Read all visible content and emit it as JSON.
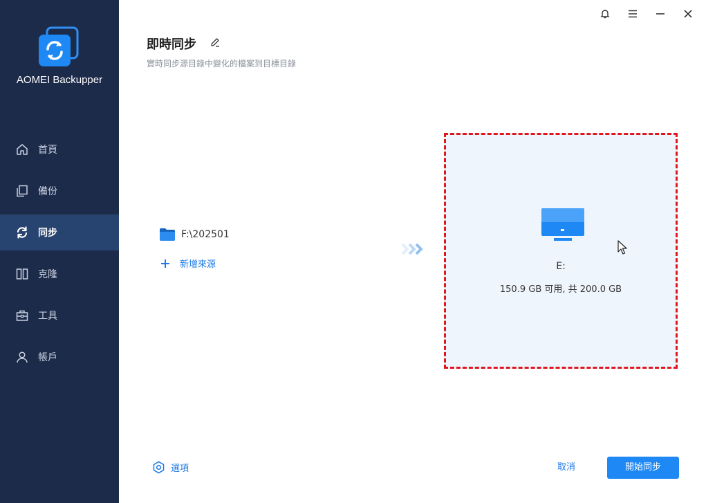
{
  "app": {
    "name": "AOMEI Backupper"
  },
  "nav": [
    {
      "label": "首頁",
      "icon": "home-icon"
    },
    {
      "label": "備份",
      "icon": "backup-icon"
    },
    {
      "label": "同步",
      "icon": "sync-icon",
      "active": true
    },
    {
      "label": "克隆",
      "icon": "clone-icon"
    },
    {
      "label": "工具",
      "icon": "tools-icon"
    },
    {
      "label": "帳戶",
      "icon": "account-icon"
    }
  ],
  "window_controls": [
    "bell-icon",
    "menu-icon",
    "minimize-icon",
    "close-icon"
  ],
  "header": {
    "title": "即時同步",
    "subtitle": "實時同步源目錄中變化的檔案到目標目錄"
  },
  "source": {
    "path": "F:\\202501",
    "add_label": "新增來源"
  },
  "destination": {
    "drive": "E:",
    "space": "150.9 GB 可用, 共 200.0 GB"
  },
  "footer": {
    "options_label": "選項",
    "cancel_label": "取消",
    "start_label": "開始同步"
  },
  "colors": {
    "sidebar_bg": "#1d2b4a",
    "sidebar_active": "#27436f",
    "accent": "#1e88f5",
    "dest_border": "#e0161e",
    "dest_bg": "#eff5fc"
  }
}
